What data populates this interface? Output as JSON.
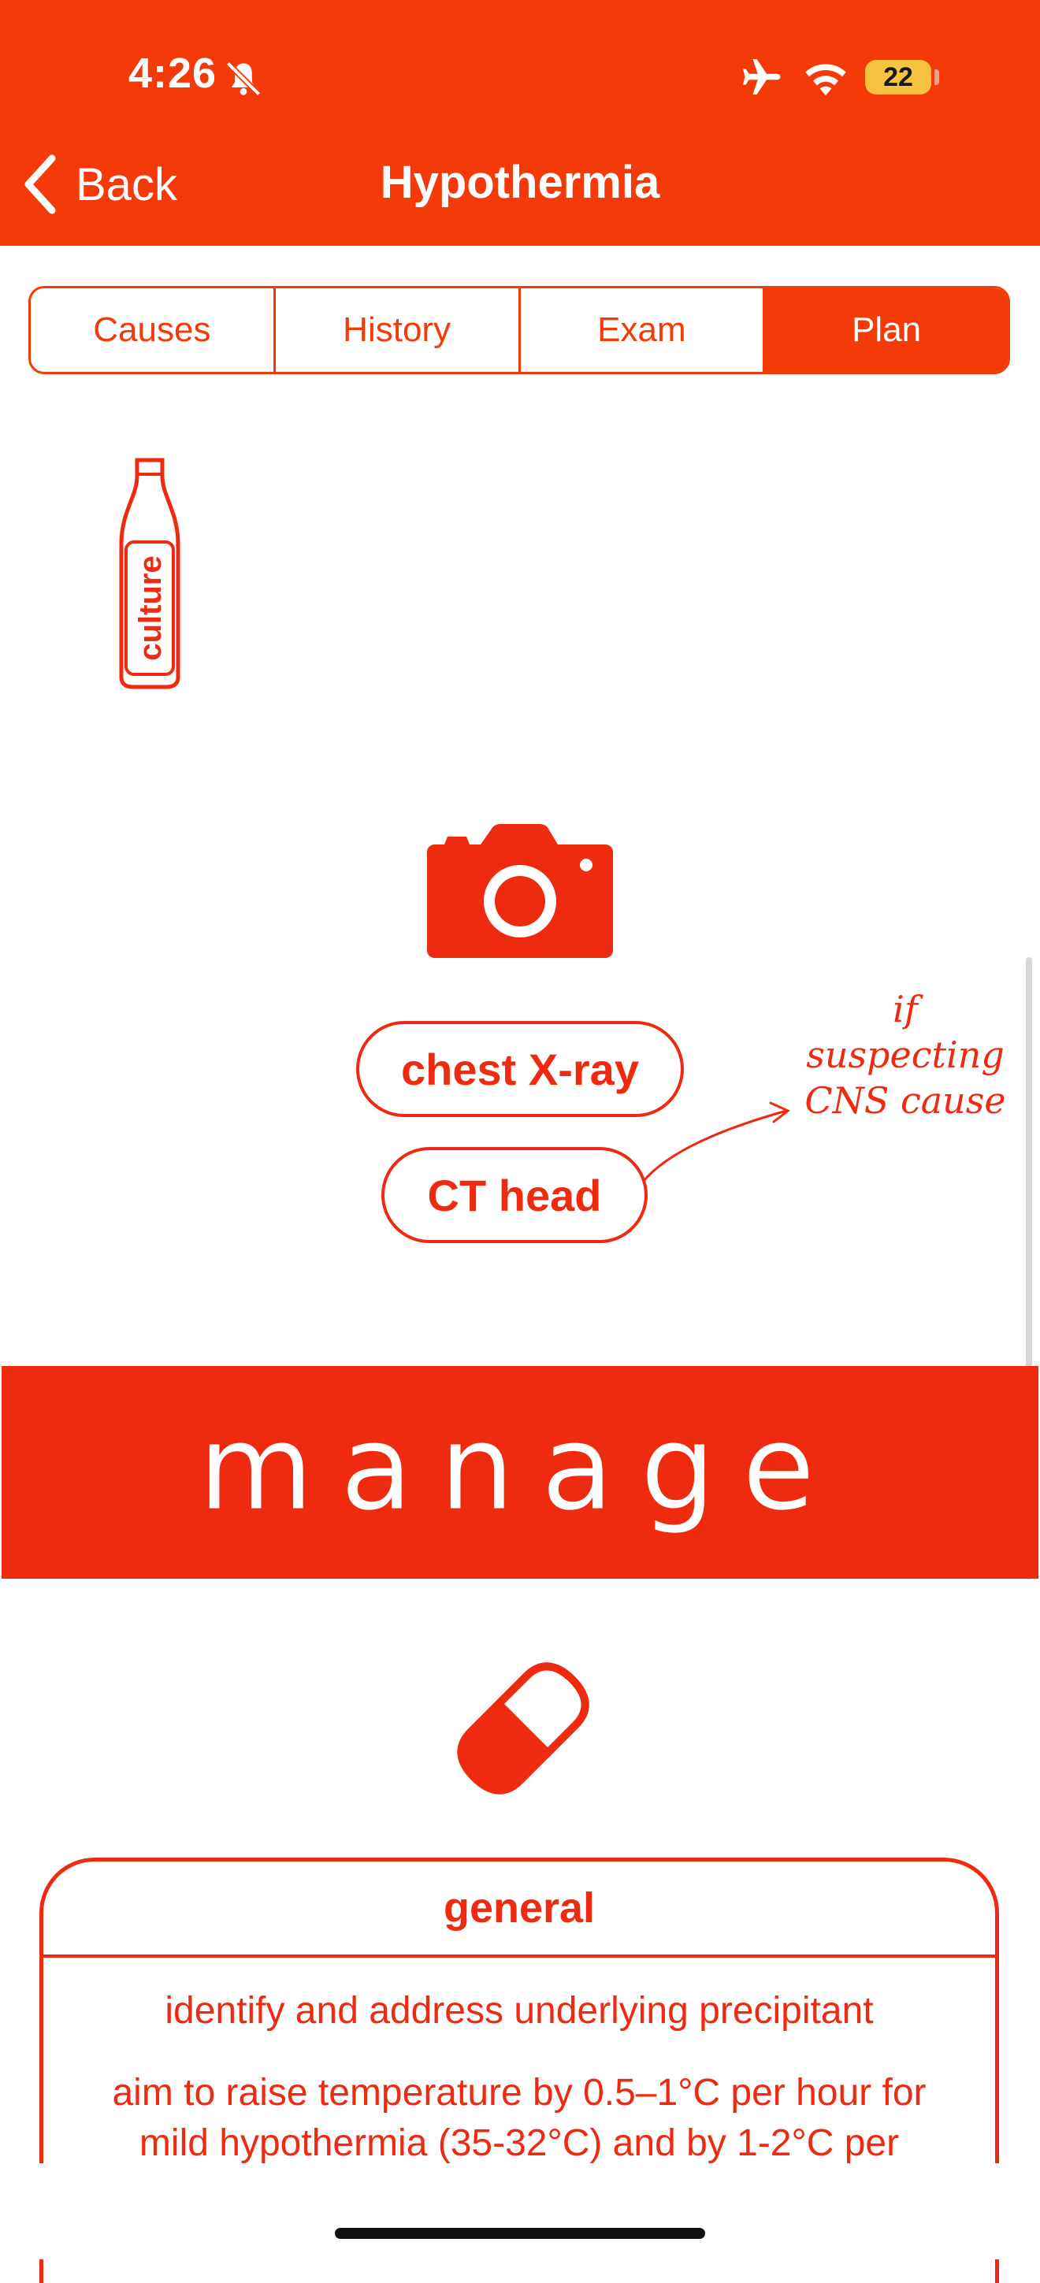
{
  "status_bar": {
    "time": "4:26",
    "battery": "22",
    "icons": [
      "bell-slash-icon",
      "airplane-icon",
      "wifi-icon",
      "battery-icon"
    ]
  },
  "nav": {
    "back_label": "Back",
    "title": "Hypothermia"
  },
  "tabs": [
    {
      "label": "Causes",
      "active": false
    },
    {
      "label": "History",
      "active": false
    },
    {
      "label": "Exam",
      "active": false
    },
    {
      "label": "Plan",
      "active": true
    }
  ],
  "investigations": {
    "bottle_label": "culture",
    "imaging": [
      "chest X-ray",
      "CT head"
    ],
    "annotation": [
      "if",
      "suspecting",
      "CNS cause"
    ]
  },
  "manage": {
    "heading": "manage"
  },
  "general_card": {
    "title": "general",
    "line1": "identify and address underlying precipitant",
    "line2": "aim to raise temperature by 0.5–1°C per hour for mild hypothermia (35-32°C) and by 1-2°C per"
  },
  "colors": {
    "header": "#F43A09",
    "accent": "#EE2A11",
    "battery": "#F5C242"
  }
}
